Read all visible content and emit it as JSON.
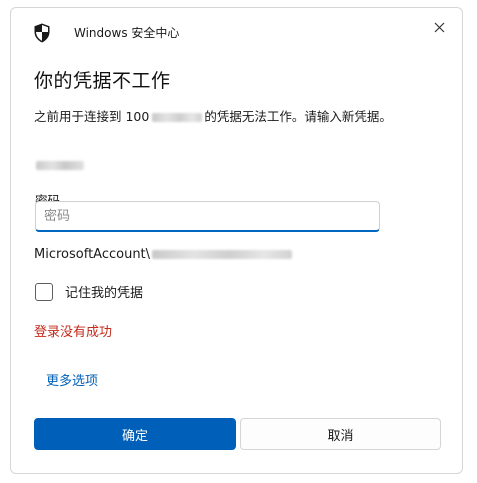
{
  "window": {
    "app_title": "Windows 安全中心",
    "close_icon": "close-icon",
    "shield_icon": "shield-icon"
  },
  "dialog": {
    "heading": "你的凭据不工作",
    "description_prefix": "之前用于连接到 100",
    "description_suffix": "的凭据无法工作。请输入新凭据。",
    "password_label": "密码",
    "password_placeholder": "密码",
    "password_value": "",
    "account_prefix": "MicrosoftAccount\\",
    "remember_label": "记住我的凭据",
    "remember_checked": false,
    "error_text": "登录没有成功",
    "more_options": "更多选项"
  },
  "buttons": {
    "ok": "确定",
    "cancel": "取消"
  },
  "colors": {
    "accent": "#005fb8",
    "error": "#c42b1c"
  }
}
